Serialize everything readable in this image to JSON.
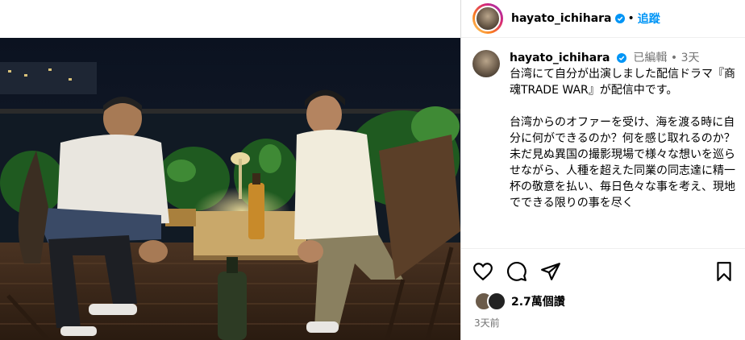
{
  "post": {
    "username": "hayato_ichihara",
    "follow_label": "追蹤",
    "separator": "•",
    "caption": {
      "username": "hayato_ichihara",
      "edited": "已編輯",
      "time": "3天",
      "text": "台湾にて自分が出演しました配信ドラマ『商魂TRADE WAR』が配信中です。\n\n台湾からのオファーを受け、海を渡る時に自分に何ができるのか？何を感じ取れるのか？未だ見ぬ異国の撮影現場で様々な想いを巡らせながら、人種を超えた同業の同志達に精一杯の敬意を払い、毎日色々な事を考え、現地でできる限りの事を尽く"
    },
    "views": "2.7萬個讚",
    "date": "3天前"
  },
  "icons": {
    "verified": "verified-badge-icon",
    "like": "heart-icon",
    "comment": "comment-icon",
    "share": "share-icon",
    "save": "bookmark-icon"
  },
  "colors": {
    "accent": "#0095f6",
    "verified": "#0095f6",
    "muted": "#737373"
  }
}
